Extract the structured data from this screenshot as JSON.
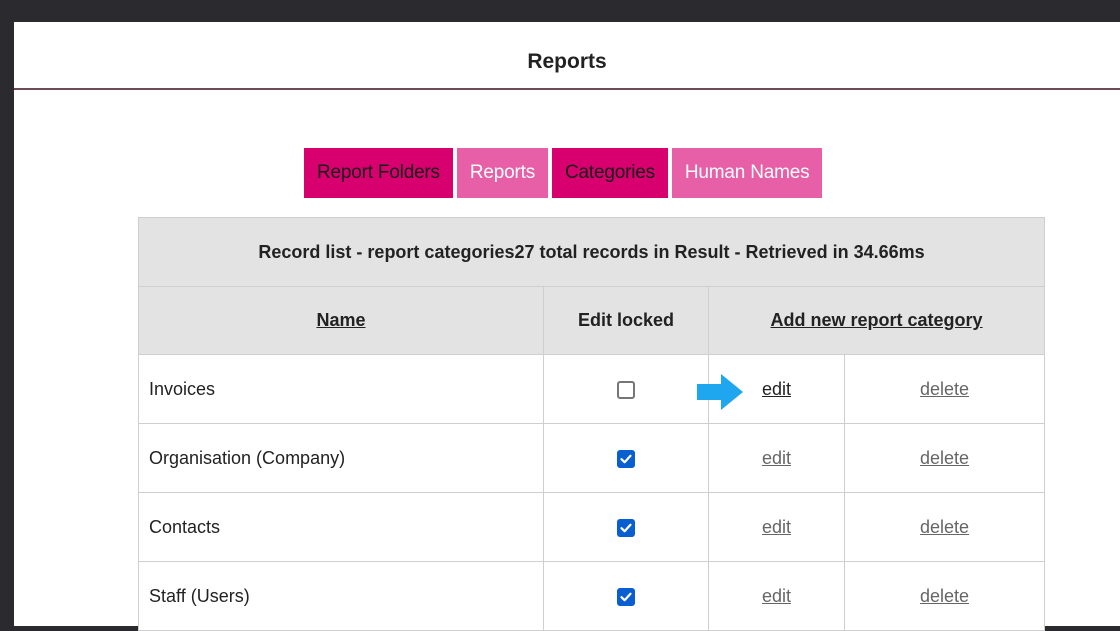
{
  "header": {
    "title": "Reports"
  },
  "tabs": [
    {
      "label": "Report Folders",
      "style": "dark"
    },
    {
      "label": "Reports",
      "style": "light"
    },
    {
      "label": "Categories",
      "style": "dark"
    },
    {
      "label": "Human Names",
      "style": "light"
    }
  ],
  "table": {
    "caption": "Record list - report categories27 total records in Result - Retrieved in 34.66ms",
    "columns": {
      "name": "Name",
      "edit_locked": "Edit locked",
      "add_new": "Add new report category"
    },
    "rows": [
      {
        "name": "Invoices",
        "locked": false,
        "edit": "edit",
        "delete": "delete"
      },
      {
        "name": "Organisation (Company)",
        "locked": true,
        "edit": "edit",
        "delete": "delete"
      },
      {
        "name": "Contacts",
        "locked": true,
        "edit": "edit",
        "delete": "delete"
      },
      {
        "name": "Staff (Users)",
        "locked": true,
        "edit": "edit",
        "delete": "delete"
      }
    ]
  },
  "colors": {
    "tab_dark": "#d8006f",
    "tab_light": "#e75fa6",
    "checkbox_checked": "#0a5fd0",
    "pointer_arrow": "#1ea7ee",
    "header_rule": "#6e4a57"
  },
  "icons": {
    "pointer": "arrow-right-icon",
    "checkbox_mark": "checkmark-icon"
  }
}
